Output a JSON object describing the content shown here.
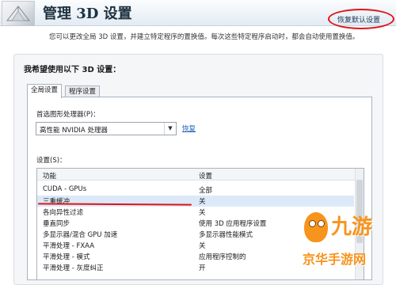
{
  "header": {
    "title": "管理 3D 设置",
    "restore_defaults": "恢复默认设置",
    "description": "您可以更改全局 3D 设置，并建立特定程序的置换值。每次这些特定程序启动时，都会自动使用置换值。"
  },
  "panel": {
    "heading": "我希望使用以下 3D 设置：",
    "tabs": [
      {
        "label": "全局设置",
        "active": true
      },
      {
        "label": "程序设置",
        "active": false
      }
    ],
    "processor_label": "首选图形处理器(P)：",
    "processor_value": "高性能 NVIDIA 处理器",
    "restore_link": "恢复",
    "settings_label": "设置(S)：",
    "table": {
      "columns": [
        "功能",
        "设置"
      ],
      "rows": [
        {
          "feature": "CUDA - GPUs",
          "setting": "全部"
        },
        {
          "feature": "三重缓冲",
          "setting": "关"
        },
        {
          "feature": "各向异性过滤",
          "setting": "关"
        },
        {
          "feature": "垂直同步",
          "setting": "使用 3D 应用程序设置"
        },
        {
          "feature": "多显示器/混合 GPU 加速",
          "setting": "多显示器性能模式"
        },
        {
          "feature": "平滑处理 - FXAA",
          "setting": "关"
        },
        {
          "feature": "平滑处理 - 模式",
          "setting": "应用程序控制的"
        },
        {
          "feature": "平滑处理 - 灰度纠正",
          "setting": "开"
        }
      ]
    }
  },
  "watermark": {
    "brand": "九游",
    "site": "京华手游网"
  },
  "colors": {
    "annotation_red": "#e0141a",
    "link_blue": "#1b5fb6",
    "watermark_orange": "#f7941d"
  }
}
